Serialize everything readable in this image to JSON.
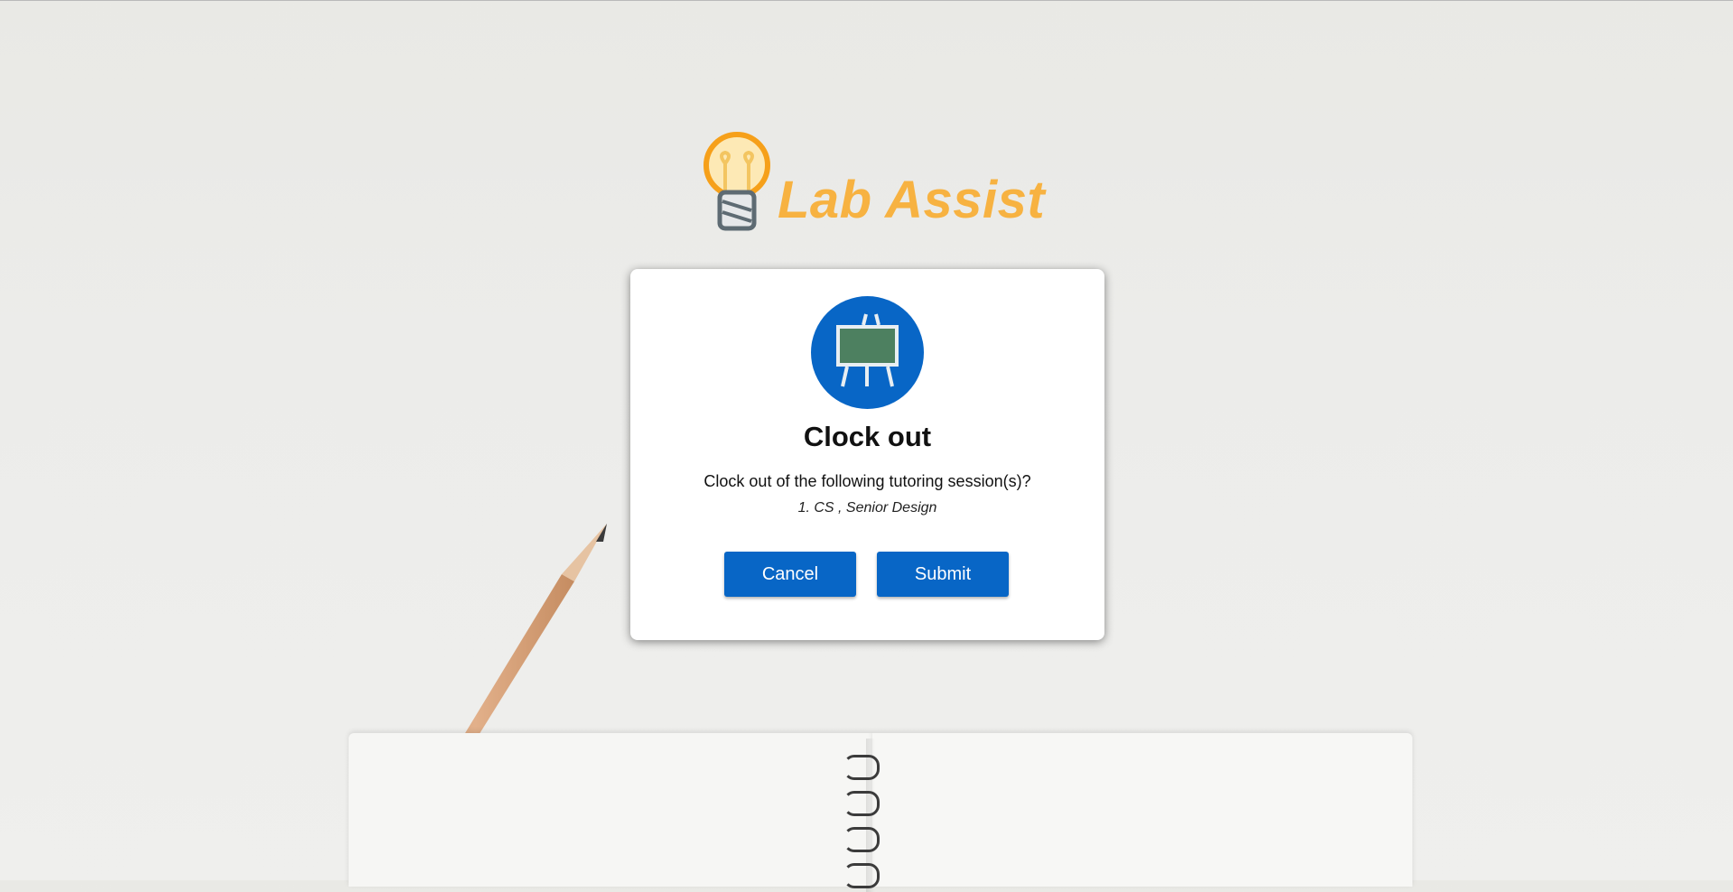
{
  "app": {
    "logo_text": "Lab Assist"
  },
  "dialog": {
    "icon": "chalkboard-easel-icon",
    "title": "Clock out",
    "message": "Clock out of the following tutoring session(s)?",
    "sessions": [
      "1. CS , Senior Design"
    ],
    "cancel_label": "Cancel",
    "submit_label": "Submit"
  },
  "colors": {
    "brand_orange": "#f7b241",
    "primary_blue": "#0866c6",
    "board_green": "#4d8060"
  }
}
